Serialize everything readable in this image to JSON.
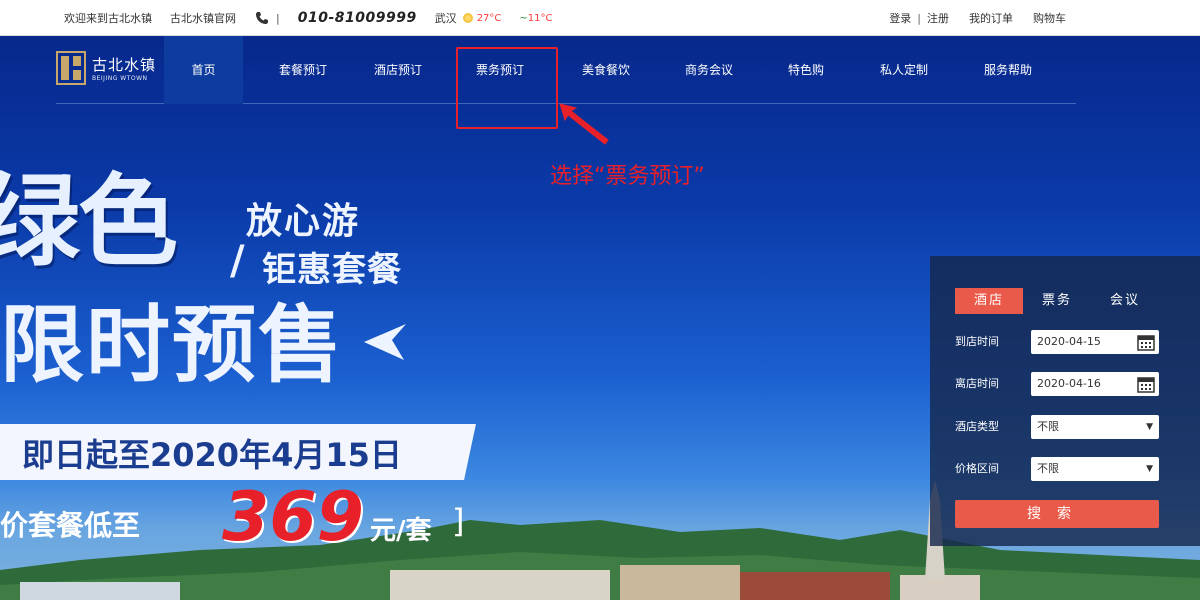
{
  "topbar": {
    "welcome": "欢迎来到古北水镇",
    "official_site": "古北水镇官网",
    "phone_sep": "|",
    "phone": "010-81009999",
    "city": "武汉",
    "temp_high": "27°C",
    "temp_sep": "~",
    "temp_low": "11°C",
    "login": "登录",
    "sep": "|",
    "register": "注册",
    "my_orders": "我的订单",
    "cart": "购物车"
  },
  "logo": {
    "cn": "古北水镇",
    "en": "BEIJING WTOWN"
  },
  "nav": {
    "items": [
      "首页",
      "套餐预订",
      "酒店预订",
      "票务预订",
      "美食餐饮",
      "商务会议",
      "特色购",
      "私人定制",
      "服务帮助"
    ],
    "active_index": 0,
    "highlighted_index": 3
  },
  "annotation": "选择“票务预订”",
  "promo": {
    "green": "绿色",
    "sub1": "放心游",
    "slash": "/",
    "sub2": "钜惠套餐",
    "limited": "限时预售",
    "date": "即日起至2020年4月15日",
    "price_label": "价套餐低至",
    "price": "369",
    "unit": "元/套",
    "bracket": "]"
  },
  "booking": {
    "tabs": [
      "酒店",
      "票务",
      "会议"
    ],
    "active_tab": 0,
    "checkin_label": "到店时间",
    "checkin_value": "2020-04-15",
    "checkout_label": "离店时间",
    "checkout_value": "2020-04-16",
    "hotel_type_label": "酒店类型",
    "hotel_type_value": "不限",
    "price_range_label": "价格区间",
    "price_range_value": "不限",
    "search_label": "搜索"
  },
  "colors": {
    "accent": "#ea5a4a",
    "annotation": "#e8202a",
    "nav_active": "#0d3b9e"
  }
}
